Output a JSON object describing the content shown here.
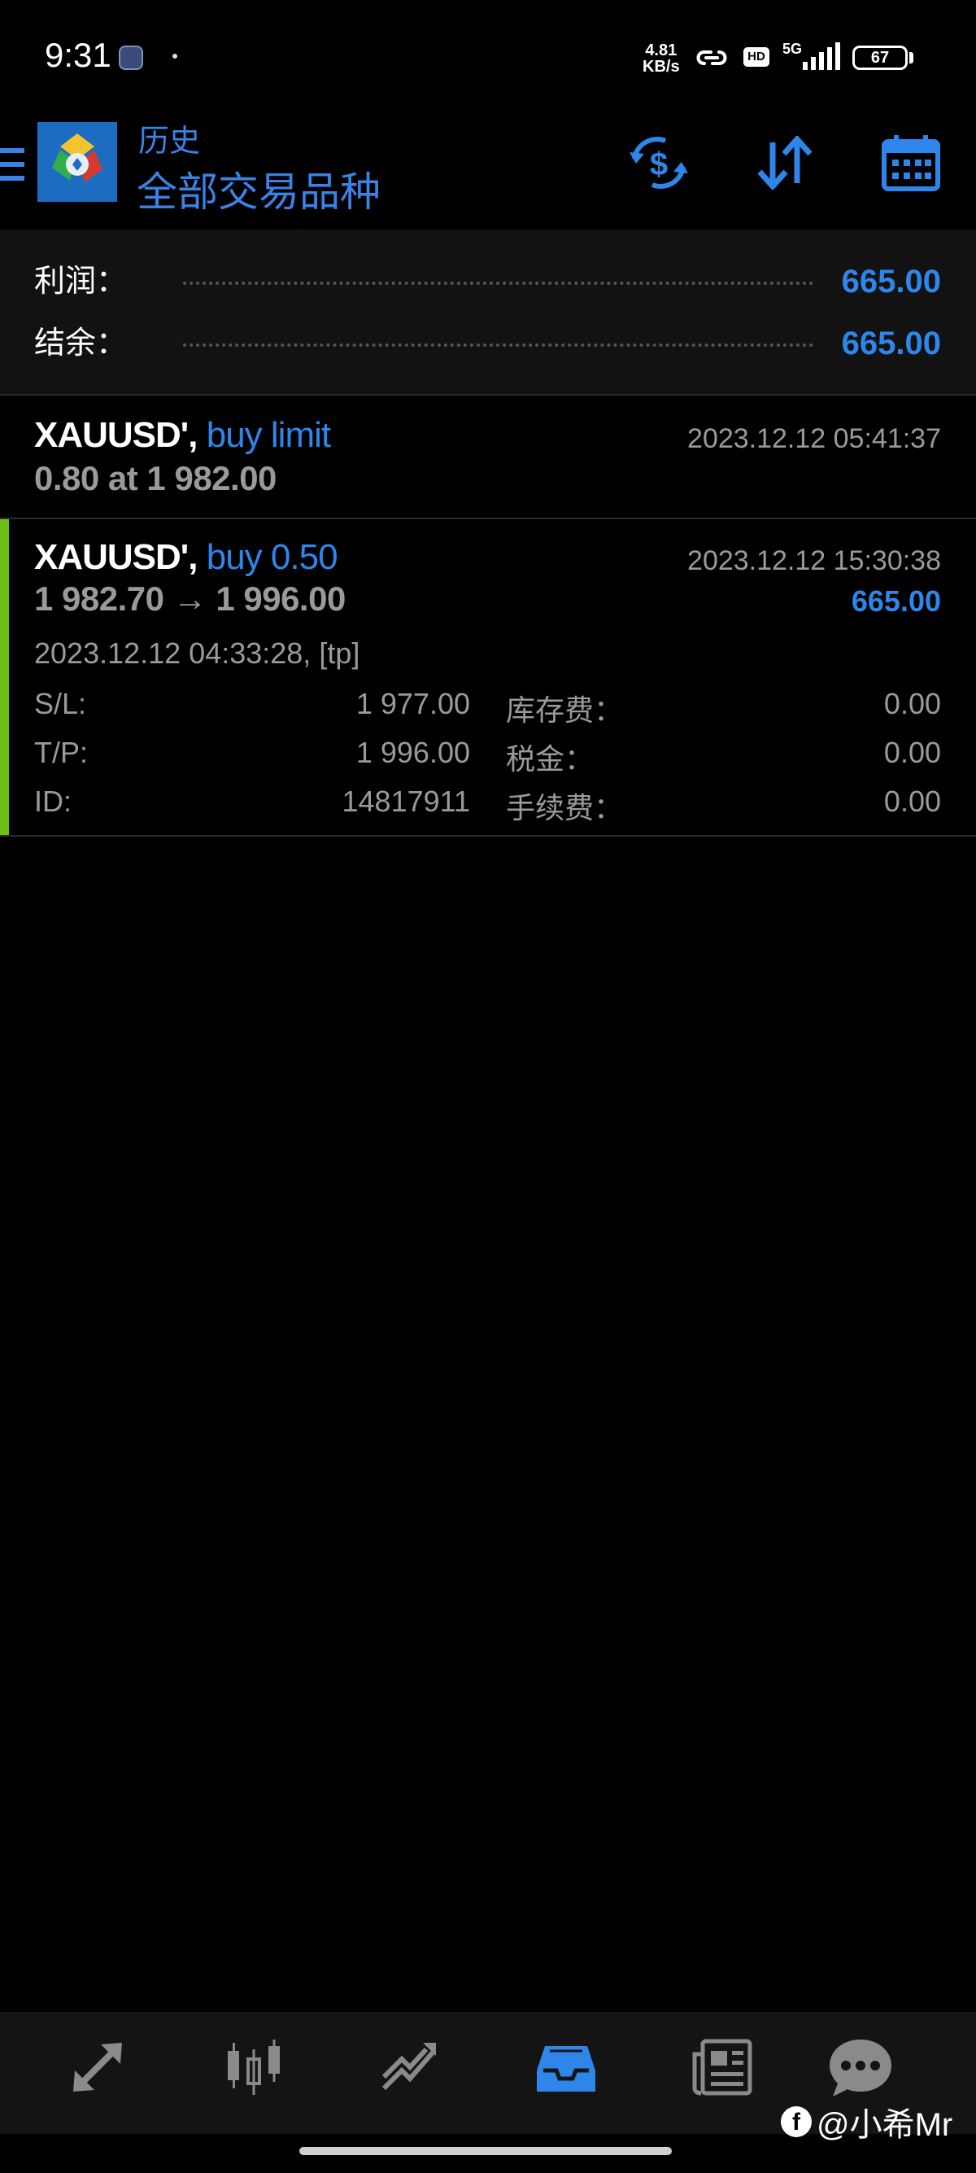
{
  "status_bar": {
    "time": "9:31",
    "net_speed_value": "4.81",
    "net_speed_unit": "KB/s",
    "hd_label": "HD",
    "network_label": "5G",
    "battery_level": "67"
  },
  "header": {
    "subtitle": "历史",
    "title": "全部交易品种"
  },
  "summary": {
    "profit_label": "利润：",
    "profit_value": "665.00",
    "balance_label": "结余：",
    "balance_value": "665.00"
  },
  "deals": [
    {
      "symbol": "XAUUSD'",
      "separator": ",",
      "type": "buy limit",
      "time": "2023.12.12 05:41:37",
      "line2": "0.80 at 1 982.00"
    },
    {
      "symbol": "XAUUSD'",
      "separator": ",",
      "type": "buy 0.50",
      "time": "2023.12.12 15:30:38",
      "line2": "1 982.70 → 1 996.00",
      "profit": "665.00",
      "open_time": "2023.12.12 04:33:28, [tp]",
      "sl_label": "S/L:",
      "sl_value": "1 977.00",
      "tp_label": "T/P:",
      "tp_value": "1 996.00",
      "id_label": "ID:",
      "id_value": "14817911",
      "swap_label": "库存费：",
      "swap_value": "0.00",
      "tax_label": "税金：",
      "tax_value": "0.00",
      "commission_label": "手续费：",
      "commission_value": "0.00"
    }
  ],
  "bottom_nav": {
    "items": [
      "quotes-icon",
      "chart-icon",
      "trade-icon",
      "history-icon",
      "news-icon",
      "chat-icon"
    ],
    "active_index": 3
  },
  "watermark": {
    "logo_letter": "f",
    "text": "@小希Mr"
  },
  "colors": {
    "accent_blue": "#2e86ea",
    "profit_bar_green": "#6fbf1a",
    "background": "#000000",
    "muted_text": "#9a9a9a"
  }
}
